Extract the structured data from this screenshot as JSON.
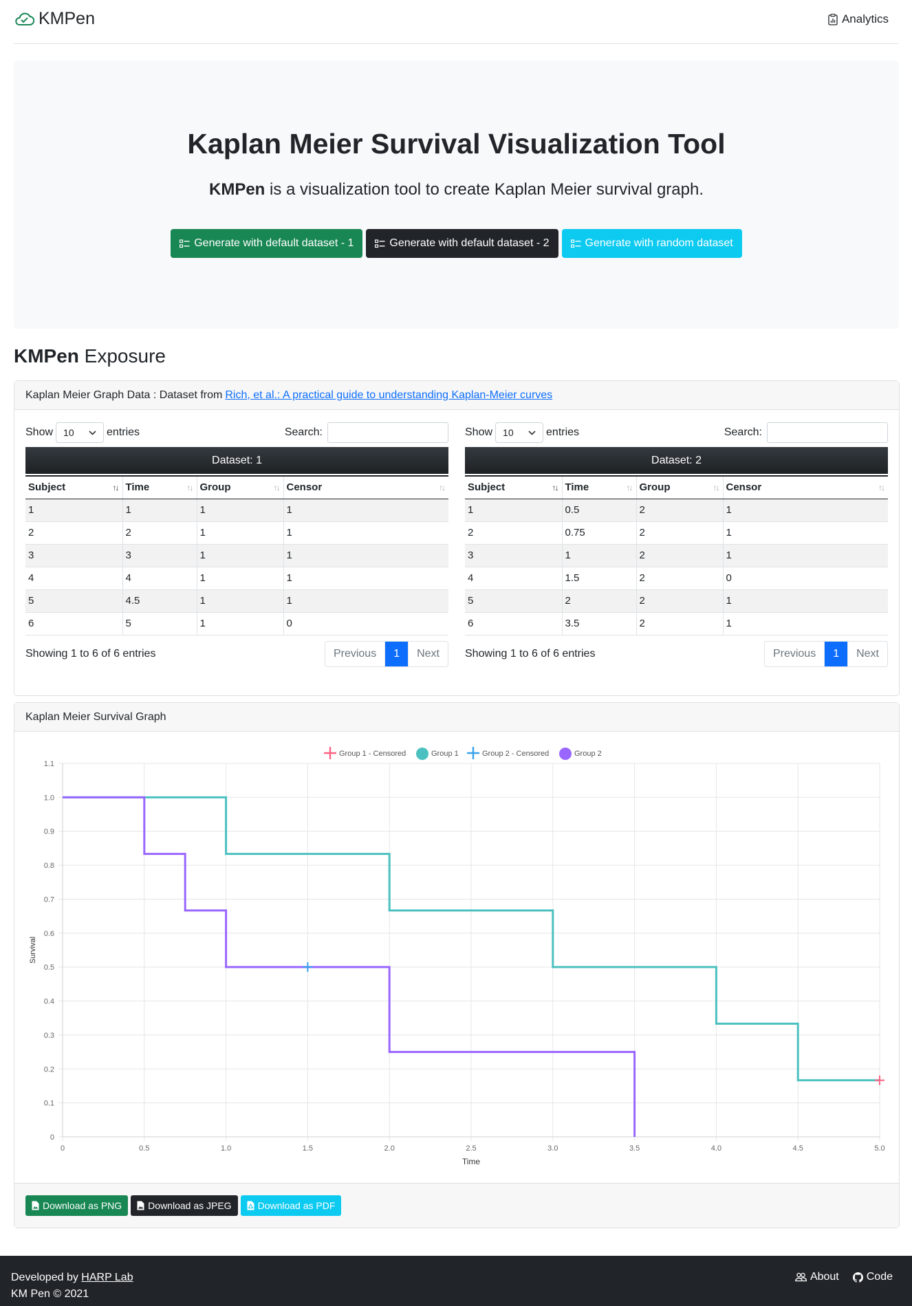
{
  "nav": {
    "brand": "KMPen",
    "analytics_label": "Analytics"
  },
  "hero": {
    "title": "Kaplan Meier Survival Visualization Tool",
    "lead_bold": "KMPen",
    "lead_rest": " is a visualization tool to create Kaplan Meier survival graph.",
    "btn_default1": "Generate with default dataset - 1",
    "btn_default2": "Generate with default dataset - 2",
    "btn_random": "Generate with random dataset"
  },
  "section": {
    "title_bold": "KMPen",
    "title_rest": " Exposure"
  },
  "data_card": {
    "header_text": "Kaplan Meier Graph Data : Dataset from",
    "header_link": "Rich, et al.: A practical guide to understanding Kaplan-Meier curves"
  },
  "tables": [
    {
      "show_label": "Show",
      "length_value": "10",
      "entries_label": "entries",
      "search_label": "Search:",
      "caption": "Dataset: 1",
      "columns": [
        "Subject",
        "Time",
        "Group",
        "Censor"
      ],
      "rows": [
        [
          "1",
          "1",
          "1",
          "1"
        ],
        [
          "2",
          "2",
          "1",
          "1"
        ],
        [
          "3",
          "3",
          "1",
          "1"
        ],
        [
          "4",
          "4",
          "1",
          "1"
        ],
        [
          "5",
          "4.5",
          "1",
          "1"
        ],
        [
          "6",
          "5",
          "1",
          "0"
        ]
      ],
      "info": "Showing 1 to 6 of 6 entries",
      "prev": "Previous",
      "page": "1",
      "next": "Next"
    },
    {
      "show_label": "Show",
      "length_value": "10",
      "entries_label": "entries",
      "search_label": "Search:",
      "caption": "Dataset: 2",
      "columns": [
        "Subject",
        "Time",
        "Group",
        "Censor"
      ],
      "rows": [
        [
          "1",
          "0.5",
          "2",
          "1"
        ],
        [
          "2",
          "0.75",
          "2",
          "1"
        ],
        [
          "3",
          "1",
          "2",
          "1"
        ],
        [
          "4",
          "1.5",
          "2",
          "0"
        ],
        [
          "5",
          "2",
          "2",
          "1"
        ],
        [
          "6",
          "3.5",
          "2",
          "1"
        ]
      ],
      "info": "Showing 1 to 6 of 6 entries",
      "prev": "Previous",
      "page": "1",
      "next": "Next"
    }
  ],
  "graph_card": {
    "header": "Kaplan Meier Survival Graph",
    "btn_png": "Download as PNG",
    "btn_jpeg": "Download as JPEG",
    "btn_pdf": "Download as PDF"
  },
  "chart_data": {
    "type": "line",
    "xlabel": "Time",
    "ylabel": "Survival",
    "xlim": [
      0,
      5
    ],
    "ylim": [
      0,
      1.1
    ],
    "x_ticks": [
      "0",
      "0.5",
      "1.0",
      "1.5",
      "2.0",
      "2.5",
      "3.0",
      "3.5",
      "4.0",
      "4.5",
      "5.0"
    ],
    "y_ticks": [
      "0",
      "0.1",
      "0.2",
      "0.3",
      "0.4",
      "0.5",
      "0.6",
      "0.7",
      "0.8",
      "0.9",
      "1.0",
      "1.1"
    ],
    "grid": true,
    "legend_position": "top",
    "legend": [
      "Group 1 - Censored",
      "Group 1",
      "Group 2 - Censored",
      "Group 2"
    ],
    "series": [
      {
        "name": "Group 1",
        "color": "#4bc0c0",
        "steps": [
          [
            0,
            1.0
          ],
          [
            1,
            1.0
          ],
          [
            1,
            0.8333
          ],
          [
            2,
            0.8333
          ],
          [
            2,
            0.6667
          ],
          [
            3,
            0.6667
          ],
          [
            3,
            0.5
          ],
          [
            4,
            0.5
          ],
          [
            4,
            0.3333
          ],
          [
            4.5,
            0.3333
          ],
          [
            4.5,
            0.1667
          ],
          [
            5,
            0.1667
          ]
        ]
      },
      {
        "name": "Group 2",
        "color": "#9966ff",
        "steps": [
          [
            0,
            1.0
          ],
          [
            0.5,
            1.0
          ],
          [
            0.5,
            0.8333
          ],
          [
            0.75,
            0.8333
          ],
          [
            0.75,
            0.6667
          ],
          [
            1,
            0.6667
          ],
          [
            1,
            0.5
          ],
          [
            2,
            0.5
          ],
          [
            2,
            0.25
          ],
          [
            3.5,
            0.25
          ],
          [
            3.5,
            0
          ]
        ]
      }
    ],
    "censored": [
      {
        "name": "Group 1 - Censored",
        "color": "#ff6384",
        "points": [
          [
            5,
            0.1667
          ]
        ]
      },
      {
        "name": "Group 2 - Censored",
        "color": "#36a2eb",
        "points": [
          [
            1.5,
            0.5
          ]
        ]
      }
    ]
  },
  "footer": {
    "developed_by": "Developed by",
    "lab_link": "HARP Lab",
    "copyright": "KM Pen © 2021",
    "about": "About",
    "code": "Code"
  }
}
